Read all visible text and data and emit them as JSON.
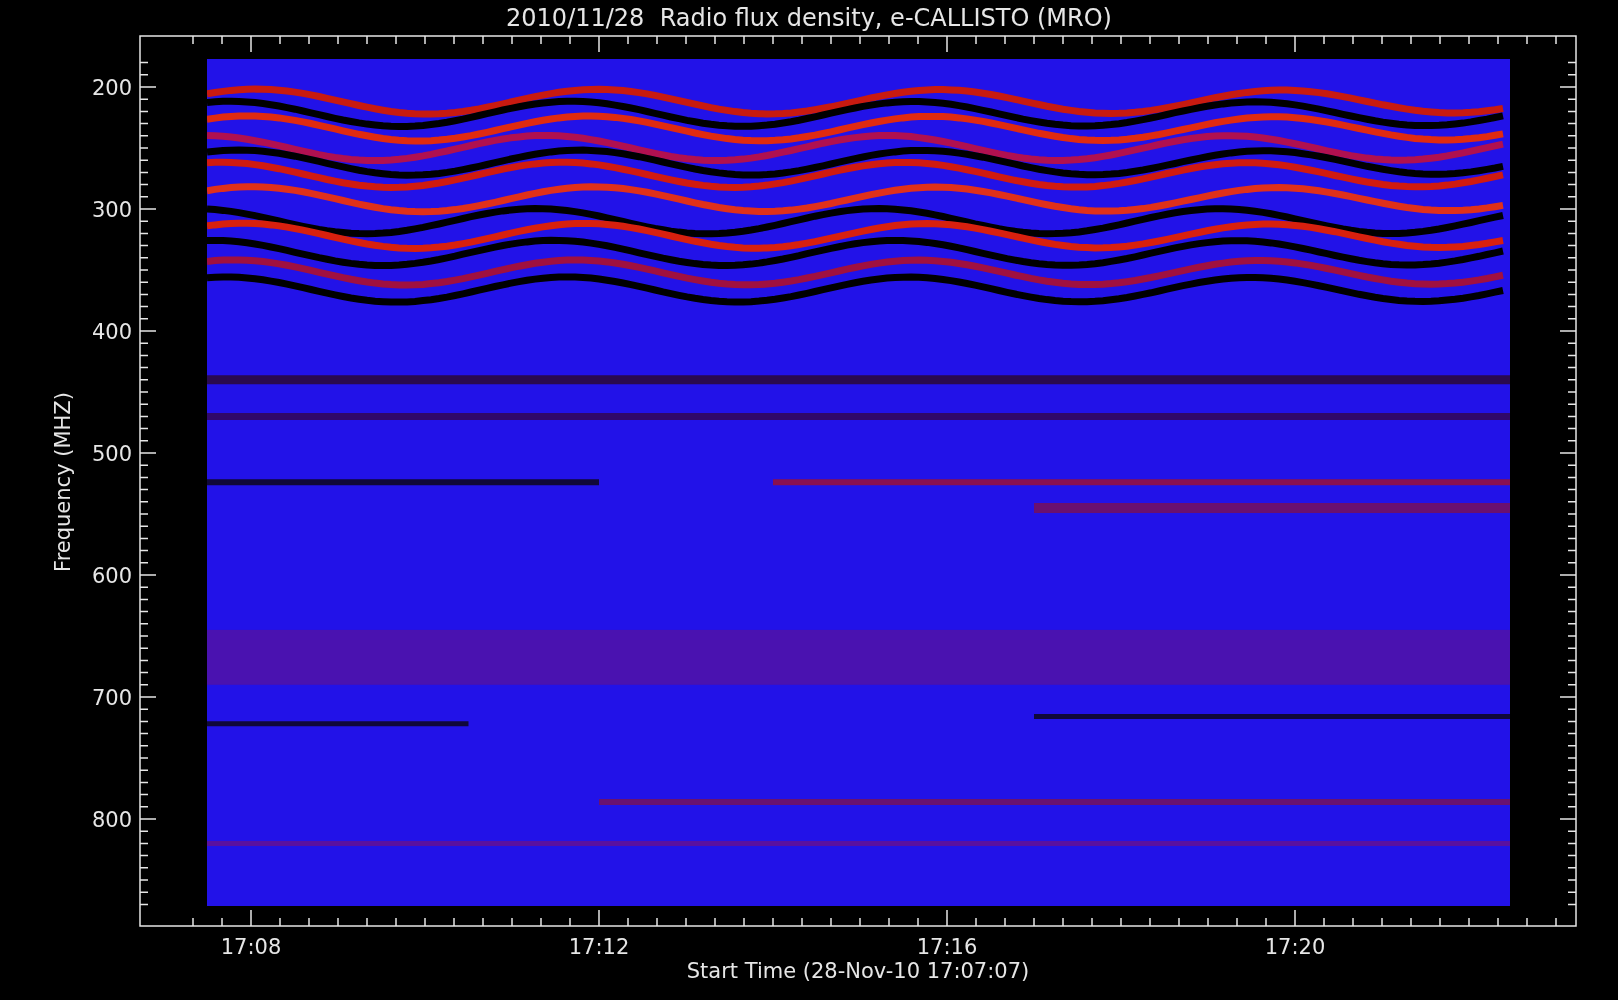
{
  "plot": {
    "title": "2010/11/28  Radio flux density, e-CALLISTO (MRO)",
    "xlabel": "Start Time (28-Nov-10 17:07:07)",
    "ylabel": "Frequency (MHZ)",
    "xticks": [
      {
        "label": "17:08"
      },
      {
        "label": "17:12"
      },
      {
        "label": "17:16"
      },
      {
        "label": "17:20"
      }
    ],
    "yticks": [
      {
        "label": "200"
      },
      {
        "label": "300"
      },
      {
        "label": "400"
      },
      {
        "label": "500"
      },
      {
        "label": "600"
      },
      {
        "label": "700"
      },
      {
        "label": "800"
      }
    ]
  }
}
